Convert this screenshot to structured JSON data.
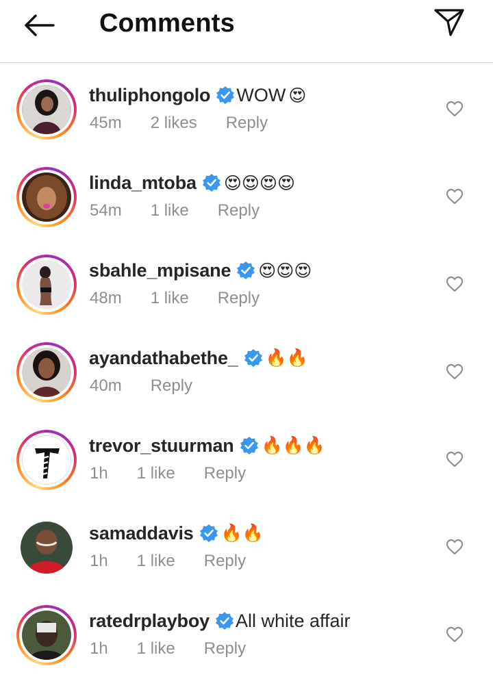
{
  "header": {
    "title": "Comments",
    "back_icon": "arrow-left-icon",
    "send_icon": "paper-plane-icon"
  },
  "colors": {
    "verified": "#3897f0",
    "meta_text": "#8e8e8e",
    "story_ring": [
      "#feda75",
      "#fa7e1e",
      "#d62976",
      "#962fbf"
    ]
  },
  "comments": [
    {
      "username": "thuliphongolo",
      "text": "WOW",
      "emojis": "😍",
      "time": "45m",
      "likes": "2 likes",
      "reply": "Reply",
      "story_ring": true
    },
    {
      "username": "linda_mtoba",
      "text": "",
      "emojis": "😍😍😍😍",
      "time": "54m",
      "likes": "1 like",
      "reply": "Reply",
      "story_ring": true
    },
    {
      "username": "sbahle_mpisane",
      "text": "",
      "emojis": "😍😍😍",
      "time": "48m",
      "likes": "1 like",
      "reply": "Reply",
      "story_ring": true
    },
    {
      "username": "ayandathabethe_",
      "text": "",
      "emojis": "🔥🔥",
      "time": "40m",
      "likes": "",
      "reply": "Reply",
      "story_ring": true
    },
    {
      "username": "trevor_stuurman",
      "text": "",
      "emojis": "🔥🔥🔥",
      "time": "1h",
      "likes": "1 like",
      "reply": "Reply",
      "story_ring": true
    },
    {
      "username": "samaddavis",
      "text": "",
      "emojis": "🔥🔥",
      "time": "1h",
      "likes": "1 like",
      "reply": "Reply",
      "story_ring": false
    },
    {
      "username": "ratedrplayboy",
      "text": "All white affair",
      "emojis": "",
      "time": "1h",
      "likes": "1 like",
      "reply": "Reply",
      "story_ring": true
    }
  ]
}
